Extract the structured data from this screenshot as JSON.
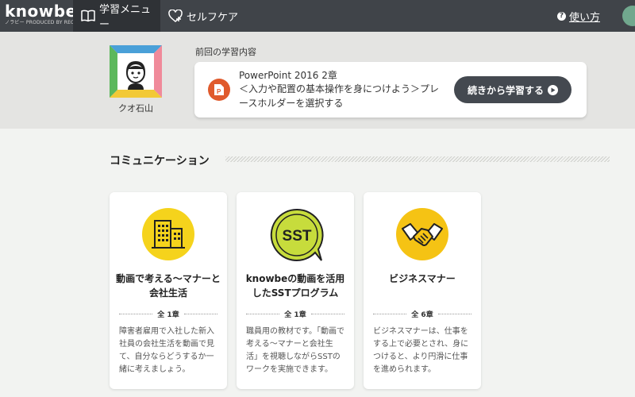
{
  "header": {
    "logo_main": "knowbe",
    "logo_sub": "ノラビー  PRODUCED BY RECRUIT",
    "nav": [
      {
        "label": "学習メニュー",
        "icon": "book-icon",
        "active": true
      },
      {
        "label": "セルフケア",
        "icon": "heart-plus-icon",
        "active": false
      }
    ],
    "help_label": "使い方",
    "colors": {
      "bar": "#404449",
      "active": "#2f3236"
    }
  },
  "profile": {
    "user_name": "クオ石山",
    "avatar_icon": "person-face-icon"
  },
  "previous": {
    "label": "前回の学習内容",
    "course_title": "PowerPoint 2016 2章",
    "lesson": "＜入力や配置の基本操作を身につけよう＞プレースホルダーを選択する",
    "resume_label": "続きから学習する",
    "app_icon": "powerpoint-icon",
    "accent": "#e05a2c"
  },
  "section": {
    "title": "コミュニケーション"
  },
  "courses": [
    {
      "title": "動画で考える～マナーと会社生活",
      "chapters": "全 1章",
      "description": "障害者雇用で入社した新入社員の会社生活を動画で見て、自分ならどうするか一緒に考えましょう。",
      "icon": "building-icon",
      "color": "#f5d31c"
    },
    {
      "title": "knowbeの動画を活用したSSTプログラム",
      "chapters": "全 1章",
      "description": "職員用の教材です。「動画で考える～マナーと会社生活」を視聴しながらSSTのワークを実施できます。",
      "icon": "sst-speech-bubble-icon",
      "color": "#c7dc3c"
    },
    {
      "title": "ビジネスマナー",
      "chapters": "全 6章",
      "description": "ビジネスマナーは、仕事をする上で必要とされ、身につけると、より円滑に仕事を進められます。",
      "icon": "handshake-icon",
      "color": "#f5c314"
    }
  ]
}
